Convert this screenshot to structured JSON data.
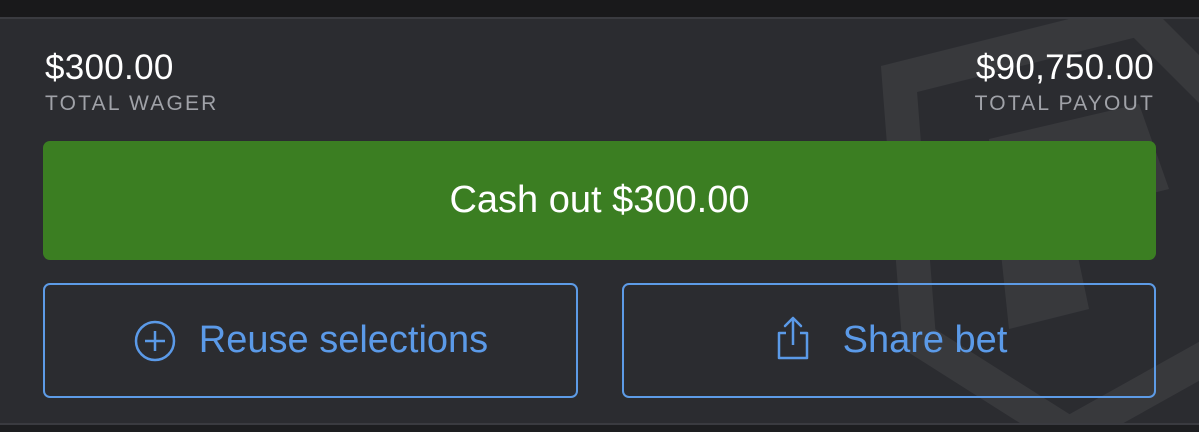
{
  "summary": {
    "total_wager_amount": "$300.00",
    "total_wager_label": "TOTAL WAGER",
    "total_payout_amount": "$90,750.00",
    "total_payout_label": "TOTAL PAYOUT"
  },
  "actions": {
    "cash_out_label": "Cash out $300.00",
    "reuse_label": "Reuse selections",
    "reuse_icon": "plus-circle-icon",
    "share_label": "Share bet",
    "share_icon": "share-icon"
  },
  "colors": {
    "card_background": "#2b2c30",
    "cash_out_green": "#3b7e22",
    "accent_blue": "#5b9ae8"
  }
}
